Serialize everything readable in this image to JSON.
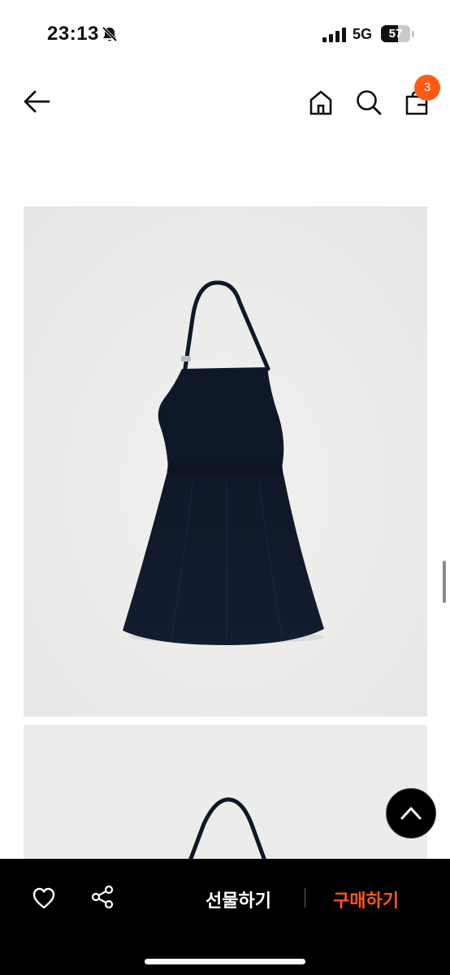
{
  "status_bar": {
    "time": "23:13",
    "network": "5G",
    "battery_level": "57",
    "battery_fraction": 0.57,
    "icons": [
      "bell-slash-icon",
      "cellular-signal-icon",
      "battery-icon"
    ]
  },
  "nav": {
    "icons": [
      "back-arrow-icon",
      "home-icon",
      "search-icon",
      "shopping-bag-icon"
    ],
    "cart_count": "3"
  },
  "product_images": [
    {
      "name": "navy-halter-mini-dress-photo-1"
    },
    {
      "name": "navy-halter-mini-dress-photo-2"
    }
  ],
  "bottom_bar": {
    "wishlist_icon": "heart-icon",
    "share_icon": "share-icon",
    "gift_label": "선물하기",
    "buy_label": "구매하기"
  },
  "colors": {
    "accent": "#ff5a14",
    "dress": "#101a2b",
    "photo_bg": "#ececea",
    "bottom_bar_bg": "#000000"
  }
}
